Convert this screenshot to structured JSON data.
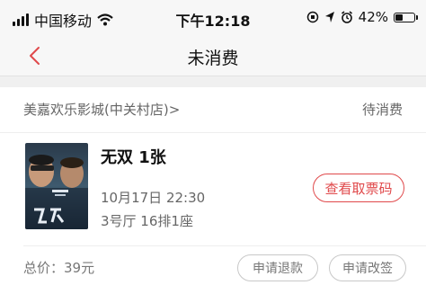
{
  "status_bar": {
    "carrier": "中国移动",
    "time": "下午12:18",
    "battery": "42%",
    "battery_level": 0.42
  },
  "nav": {
    "title": "未消费"
  },
  "order": {
    "cinema": "美嘉欢乐影城(中关村店)",
    "status": "待消费",
    "movie": "无双 1张",
    "show_time": "10月17日 22:30",
    "seat": "3号厅 16排1座",
    "ticket_button": "查看取票码",
    "total": "总价：39元",
    "refund_button": "申请退款",
    "change_button": "申请改签"
  },
  "colors": {
    "accent": "#e0494b",
    "nav_bg": "#f7f7f7"
  }
}
